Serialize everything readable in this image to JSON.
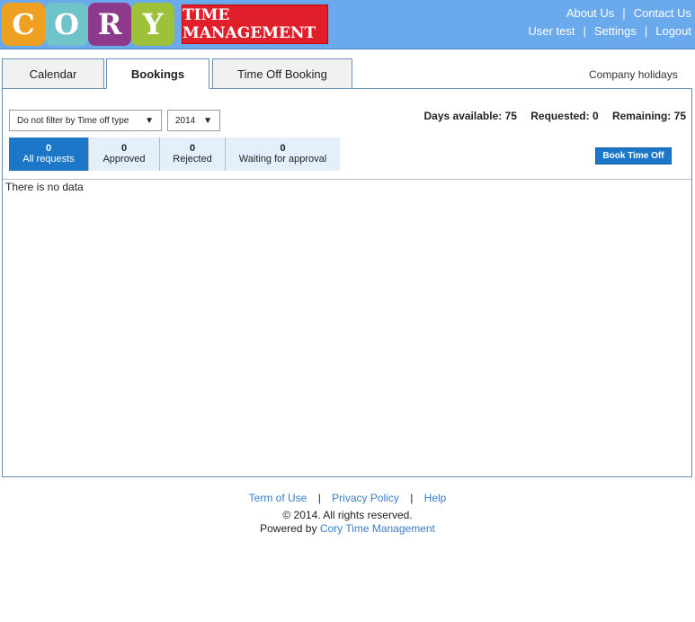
{
  "logo": {
    "letters": [
      "C",
      "O",
      "R",
      "Y"
    ],
    "colors": [
      "#f0a020",
      "#6fc3c9",
      "#8e3a8c",
      "#9dc23a"
    ],
    "tagline": "TIME MANAGEMENT"
  },
  "top_links": {
    "about": "About Us",
    "contact": "Contact Us",
    "user": "User test",
    "settings": "Settings",
    "logout": "Logout",
    "sep": "|"
  },
  "tabs": [
    {
      "label": "Calendar"
    },
    {
      "label": "Bookings"
    },
    {
      "label": "Time Off Booking"
    }
  ],
  "company_holidays": "Company holidays",
  "filters": {
    "type": "Do not filter by Time off type",
    "year": "2014"
  },
  "summary": {
    "available": "Days available: 75",
    "requested": "Requested: 0",
    "remaining": "Remaining: 75"
  },
  "stats": [
    {
      "count": "0",
      "label": "All requests"
    },
    {
      "count": "0",
      "label": "Approved"
    },
    {
      "count": "0",
      "label": "Rejected"
    },
    {
      "count": "0",
      "label": "Waiting for approval"
    }
  ],
  "book_button": "Book Time Off",
  "empty": "There is no data",
  "footer": {
    "terms": "Term of Use",
    "privacy": "Privacy Policy",
    "help": "Help",
    "sep": "|",
    "copyright": "© 2014. All rights reserved.",
    "powered": "Powered by",
    "company": "Cory Time Management"
  }
}
